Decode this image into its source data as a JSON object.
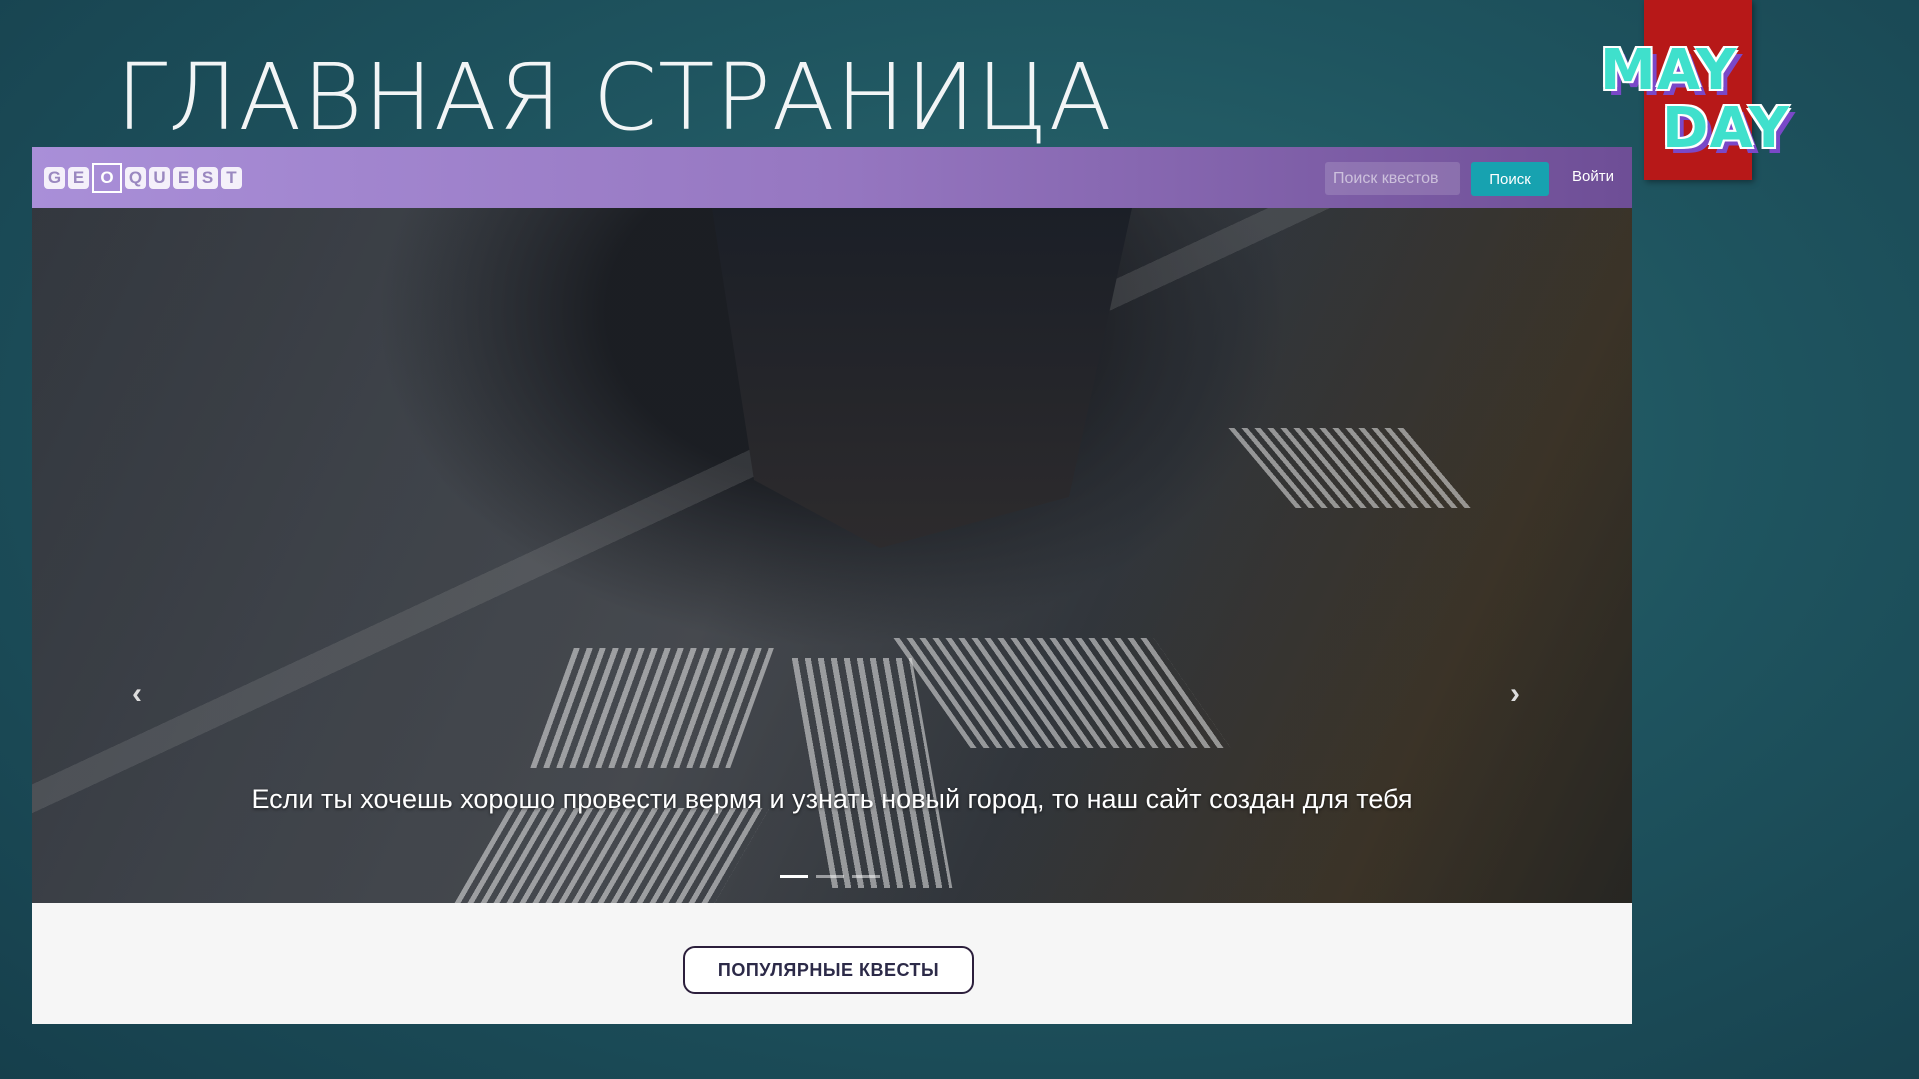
{
  "slide_title": "ГЛАВНАЯ СТРАНИЦА",
  "badge": {
    "line1": "MAY",
    "line2": "DAY",
    "color": "#b71818"
  },
  "navbar": {
    "logo_letters": [
      "G",
      "E",
      "O",
      "Q",
      "U",
      "E",
      "S",
      "T"
    ],
    "search_placeholder": "Поиск квестов",
    "search_button": "Поиск",
    "login": "Войти"
  },
  "carousel": {
    "caption": "Если ты хочешь хорошо провести вермя и узнать новый город, то наш сайт создан для тебя",
    "slides": 3,
    "active": 1,
    "prev_icon": "‹",
    "next_icon": "›"
  },
  "popular_button": "ПОПУЛЯРНЫЕ КВЕСТЫ"
}
